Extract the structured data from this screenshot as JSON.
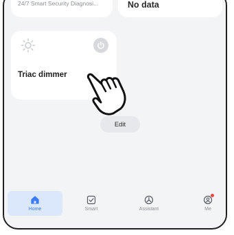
{
  "cards": {
    "top_left": {
      "subtitle": "24/7 Smart Security Diagnosi..."
    },
    "top_right": {
      "value": "No data"
    },
    "dimmer": {
      "name": "Triac dimmer",
      "power_icon": "power-icon",
      "status_icon": "sun-icon"
    }
  },
  "edit_label": "Edit",
  "nav": {
    "items": [
      {
        "label": "Home",
        "icon": "home-icon",
        "active": true
      },
      {
        "label": "Smart",
        "icon": "checkbox-icon",
        "active": false
      },
      {
        "label": "Assistant",
        "icon": "assistant-icon",
        "active": false
      },
      {
        "label": "Me",
        "icon": "profile-icon",
        "active": false
      }
    ]
  },
  "colors": {
    "accent": "#3a7bf6",
    "nav_active_bg": "#dbe7fb",
    "notification": "#f04646"
  }
}
